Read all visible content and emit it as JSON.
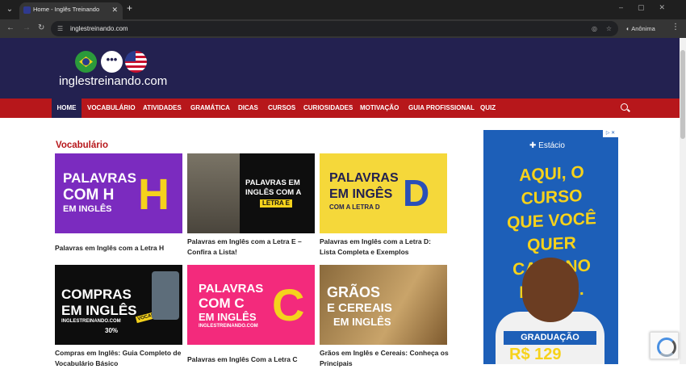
{
  "browser": {
    "tab_title": "Home - Inglês Treinando",
    "url": "inglestreinando.com",
    "incognito_label": "Anônima"
  },
  "site": {
    "logo_text": "inglestreinando.com",
    "logo_bubble": "•••"
  },
  "nav": {
    "items": [
      "HOME",
      "VOCABULÁRIO",
      "ATIVIDADES",
      "GRAMÁTICA",
      "DICAS",
      "CURSOS",
      "CURIOSIDADES",
      "MOTIVAÇÃO",
      "GUIA PROFISSIONAL",
      "QUIZ"
    ]
  },
  "section": {
    "title": "Vocabulário"
  },
  "posts": [
    {
      "title": "Palavras em Inglês com a Letra H",
      "img_text": [
        "PALAVRAS",
        "COM H",
        "EM INGLÊS"
      ],
      "img_letter": "H"
    },
    {
      "title": "Palavras em Inglês com a Letra E – Confira a Lista!",
      "img_text": [
        "PALAVRAS EM",
        "INGLÊS COM A",
        "LETRA E"
      ]
    },
    {
      "title": "Palavras em Inglês com a Letra D: Lista Completa e Exemplos",
      "img_text": [
        "PALAVRAS",
        "EM INGÊS",
        "COM A LETRA D"
      ],
      "img_letter": "D"
    },
    {
      "title": "Compras em Inglês: Guia Completo de Vocabulário Básico",
      "img_text": [
        "COMPRAS",
        "EM INGLÊS",
        "INGLESTREINANDO.COM",
        "VOCABULÁRIO",
        "30%"
      ]
    },
    {
      "title": "Palavras em Inglês Com a Letra C",
      "img_text": [
        "PALAVRAS",
        "COM C",
        "EM INGLÊS",
        "INGLESTREINANDO.COM"
      ],
      "img_letter": "C"
    },
    {
      "title": "Grãos em Inglês e Cereais: Conheça os Principais",
      "img_text": [
        "GRÃOS",
        "E CEREAIS",
        "EM INGLÊS"
      ]
    }
  ],
  "ad": {
    "brand": "Estácio",
    "headline": [
      "AQUI, O CURSO",
      "QUE VOCÊ QUER",
      "CABE NO BOLSO."
    ],
    "badge": "GRADUAÇÃO",
    "price": "R$ 129",
    "adchoice": "▷ ✕"
  },
  "colors": {
    "header_bg": "#232150",
    "nav_bg": "#b7171b",
    "section_title": "#b7171b"
  }
}
